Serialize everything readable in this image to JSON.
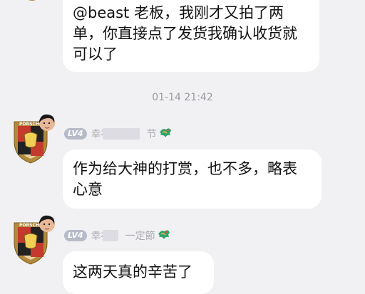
{
  "messages": [
    {
      "text": "@beast 老板，我刚才又拍了两单，你直接点了发货我确认收货就可以了"
    },
    {
      "text": "作为给大神的打赏，也不多，略表心意"
    },
    {
      "text": "这两天真的辛苦了"
    }
  ],
  "timestamp": "01-14 21:42",
  "sender": {
    "level": "LV4",
    "name_visible_1": "幸福",
    "name_suffix_1": "节",
    "name_visible_2": "幸福",
    "name_suffix_2": "一定節"
  },
  "icons": {
    "avatar": "porsche-crest-avatar",
    "medal": "dragon-medal-icon"
  },
  "colors": {
    "background": "#f1f1f3",
    "bubble": "#ffffff",
    "badge": "#b7bbc8",
    "meta_text": "#9a9aa2"
  }
}
